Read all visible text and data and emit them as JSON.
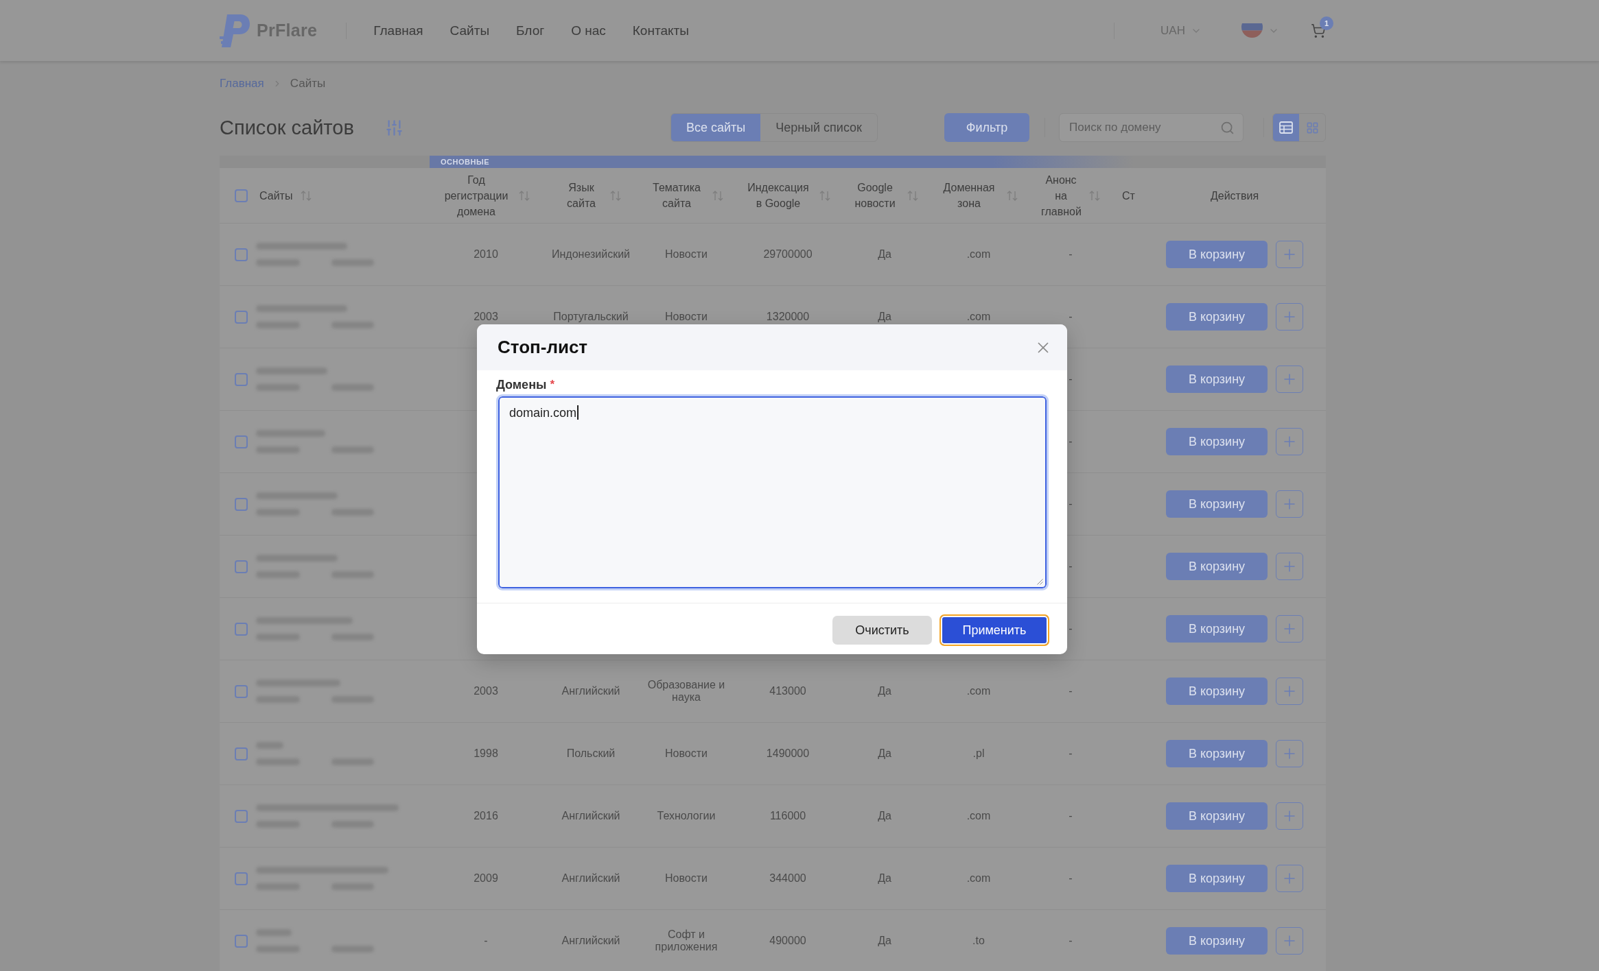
{
  "header": {
    "logo_text": "PrFlare",
    "nav": [
      "Главная",
      "Сайты",
      "Блог",
      "О нас",
      "Контакты"
    ],
    "currency": "UAH",
    "cart_count": "1"
  },
  "breadcrumbs": [
    {
      "label": "Главная",
      "current": false
    },
    {
      "label": "Сайты",
      "current": true
    }
  ],
  "page_title": "Список сайтов",
  "list_tabs": [
    {
      "label": "Все сайты",
      "selected": true
    },
    {
      "label": "Черный список",
      "selected": false
    }
  ],
  "filter_button": "Фильтр",
  "search": {
    "placeholder": "Поиск по домену"
  },
  "view_modes": [
    {
      "kind": "table",
      "selected": true
    },
    {
      "kind": "grid",
      "selected": false
    }
  ],
  "table": {
    "group_label": "ОСНОВНЫЕ",
    "select_all": {
      "checked": false
    },
    "columns": [
      {
        "label": "Сайты",
        "sortable": true
      },
      {
        "label": "Год регистрации домена",
        "sortable": true
      },
      {
        "label": "Язык сайта",
        "sortable": true
      },
      {
        "label": "Тематика сайта",
        "sortable": true
      },
      {
        "label": "Индексация в Google",
        "sortable": true
      },
      {
        "label": "Google новости",
        "sortable": true
      },
      {
        "label": "Доменная зона",
        "sortable": true
      },
      {
        "label": "Анонс на главной",
        "sortable": true
      },
      {
        "label": "Ст",
        "sortable": false
      }
    ],
    "actions_label": "Действия",
    "rows": [
      {
        "checked": false,
        "year": "2010",
        "language": "Индонезийский",
        "topic": "Новости",
        "indexed": "29700000",
        "google_news": "Да",
        "zone": ".com",
        "announce": "-",
        "cart_button": "В корзину"
      },
      {
        "checked": false,
        "year": "2003",
        "language": "Португальский",
        "topic": "Новости",
        "indexed": "1320000",
        "google_news": "Да",
        "zone": ".com",
        "announce": "-",
        "cart_button": "В корзину"
      },
      {
        "checked": false,
        "announce": "-",
        "cart_button": "В корзину"
      },
      {
        "checked": false,
        "announce": "-",
        "cart_button": "В корзину"
      },
      {
        "checked": false,
        "announce": "-",
        "cart_button": "В корзину"
      },
      {
        "checked": false,
        "announce": "-",
        "cart_button": "В корзину"
      },
      {
        "checked": false,
        "announce": "-",
        "cart_button": "В корзину"
      },
      {
        "checked": false,
        "year": "2003",
        "language": "Английский",
        "topic": "Образование и наука",
        "indexed": "413000",
        "google_news": "Да",
        "zone": ".com",
        "announce": "-",
        "cart_button": "В корзину"
      },
      {
        "checked": false,
        "year": "1998",
        "language": "Польский",
        "topic": "Новости",
        "indexed": "1490000",
        "google_news": "Да",
        "zone": ".pl",
        "announce": "-",
        "cart_button": "В корзину"
      },
      {
        "checked": false,
        "year": "2016",
        "language": "Английский",
        "topic": "Технологии",
        "indexed": "116000",
        "google_news": "Да",
        "zone": ".com",
        "announce": "-",
        "cart_button": "В корзину"
      },
      {
        "checked": false,
        "year": "2009",
        "language": "Английский",
        "topic": "Новости",
        "indexed": "344000",
        "google_news": "Да",
        "zone": ".com",
        "announce": "-",
        "cart_button": "В корзину"
      },
      {
        "checked": false,
        "year": "-",
        "language": "Английский",
        "topic": "Софт и приложения",
        "indexed": "490000",
        "google_news": "Да",
        "zone": ".to",
        "announce": "-",
        "cart_button": "В корзину"
      }
    ]
  },
  "modal": {
    "title": "Стоп-лист",
    "field": {
      "label": "Домены",
      "required_mark": "*",
      "value": "domain.com",
      "focused": true
    },
    "buttons": [
      {
        "label": "Очистить",
        "kind": "secondary",
        "focused": false
      },
      {
        "label": "Применить",
        "kind": "primary",
        "focused": true
      }
    ]
  }
}
